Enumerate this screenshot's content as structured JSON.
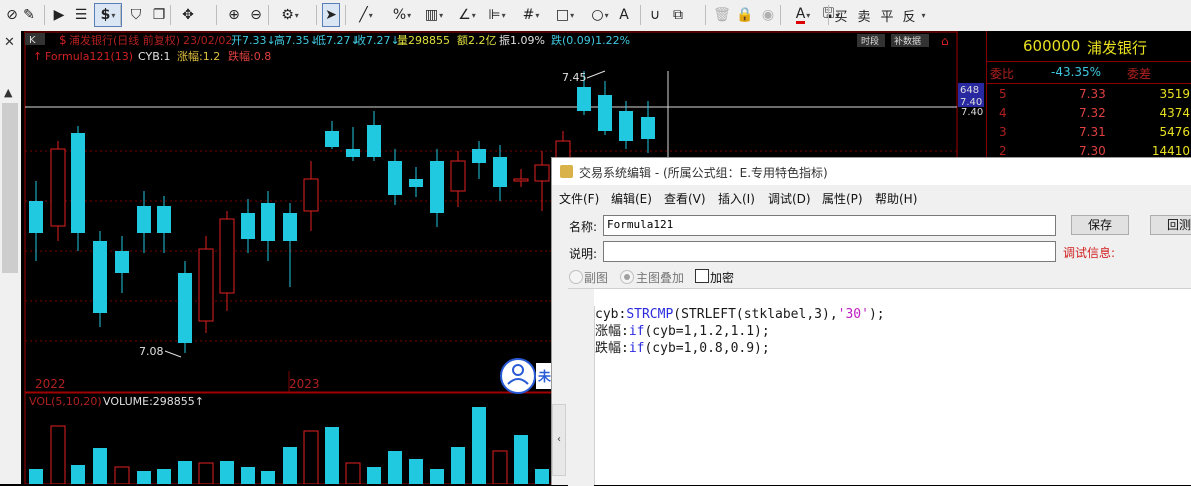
{
  "toolbar": {
    "items": [
      {
        "icon": "pointer-mode-icon",
        "glyph": "⊘"
      },
      {
        "icon": "edit-icon",
        "glyph": "✎"
      },
      {
        "icon": "play-icon",
        "glyph": "▶"
      },
      {
        "icon": "report-icon",
        "glyph": "☰"
      },
      {
        "icon": "dollar-icon",
        "glyph": "$"
      },
      {
        "icon": "filter-icon",
        "glyph": "⛉"
      },
      {
        "icon": "layers-icon",
        "glyph": "❐"
      },
      {
        "icon": "move-icon",
        "glyph": "✥"
      },
      {
        "icon": "zoom-in-icon",
        "glyph": "⊕"
      },
      {
        "icon": "zoom-out-icon",
        "glyph": "⊖"
      },
      {
        "icon": "settings-icon",
        "glyph": "⚙"
      },
      {
        "icon": "cursor-icon",
        "glyph": "➤"
      },
      {
        "icon": "line-tool-icon",
        "glyph": "╱"
      },
      {
        "icon": "percent-icon",
        "glyph": "%"
      },
      {
        "icon": "ruler-icon",
        "glyph": "▥"
      },
      {
        "icon": "angle-icon",
        "glyph": "∠"
      },
      {
        "icon": "align-icon",
        "glyph": "⊫"
      },
      {
        "icon": "grid-icon",
        "glyph": "#"
      },
      {
        "icon": "rectangle-icon",
        "glyph": "□"
      },
      {
        "icon": "circle-icon",
        "glyph": "○"
      },
      {
        "icon": "text-icon",
        "glyph": "A"
      },
      {
        "icon": "magnet-icon",
        "glyph": "∪"
      },
      {
        "icon": "copy-icon",
        "glyph": "⧉"
      },
      {
        "icon": "delete-icon",
        "glyph": "🗑"
      },
      {
        "icon": "lock-icon",
        "glyph": "🔒"
      },
      {
        "icon": "eye-icon",
        "glyph": "◉"
      },
      {
        "icon": "font-color-icon",
        "glyph": "A"
      },
      {
        "icon": "save-icon",
        "glyph": "🖫"
      }
    ],
    "trade_buttons": [
      "买",
      "卖",
      "平",
      "反"
    ]
  },
  "chart": {
    "period_tag": "K",
    "header_name": "浦发银行(日线 前复权)",
    "header_date": "23/02/02",
    "header_open": "开7.33↓",
    "header_high": "高7.35↓",
    "header_low": "低7.27↓",
    "header_close": "收7.27↓",
    "header_volume": "量298855",
    "header_amount": "额2.2亿",
    "header_amplitude": "振1.09%",
    "header_change": "跌(0.09)1.22%",
    "btn_time": "时段",
    "btn_fuquan": "补数据",
    "formula_name": "Formula121(13)",
    "formula_cyb": "CYB:1",
    "formula_zhangfu": "涨幅:1.2",
    "formula_diefu": "跌幅:0.8",
    "high_label": "7.45",
    "low_label": "7.08",
    "axis_label_1": "2022",
    "axis_label_2": "2023",
    "price_tag_1": "648",
    "price_tag_2": "7.40",
    "price_tag_3": "7.40",
    "volume_title": "VOL(5,10,20)",
    "volume_value": "VOLUME:298855↑",
    "float_icon_text": "未"
  },
  "chart_data": {
    "type": "candlestick",
    "low_label": 7.08,
    "high_label": 7.45,
    "volume_last": 298855
  },
  "quote_panel": {
    "code": "600000",
    "name": "浦发银行",
    "weibi_label": "委比",
    "weibi_value": "-43.35%",
    "weicha_label": "委差",
    "levels": [
      {
        "level": "5",
        "price": "7.33",
        "volume": "3519"
      },
      {
        "level": "4",
        "price": "7.32",
        "volume": "4374"
      },
      {
        "level": "3",
        "price": "7.31",
        "volume": "5476"
      },
      {
        "level": "2",
        "price": "7.30",
        "volume": "14410"
      }
    ]
  },
  "dialog": {
    "title": "交易系统编辑 - (所属公式组：E.专用特色指标)",
    "menu": [
      "文件(F)",
      "编辑(E)",
      "查看(V)",
      "插入(I)",
      "调试(D)",
      "属性(P)",
      "帮助(H)"
    ],
    "name_label": "名称:",
    "name_value": "Formula121",
    "desc_label": "说明:",
    "desc_value": "",
    "save_button": "保存",
    "return_button": "回测",
    "debug_info": "调试信息:",
    "radio_sub": "副图",
    "radio_main": "主图叠加",
    "check_encrypt": "加密",
    "code_line1_var": "cyb:",
    "code_line1_fn": "STRCMP",
    "code_line1_mid": "(STRLEFT(stklabel,3),",
    "code_line1_str": "'30'",
    "code_line1_end": ");",
    "code_line2_var": "涨幅:",
    "code_line2_kw": "if",
    "code_line2_rest": "(cyb=1,1.2,1.1);",
    "code_line3_var": "跌幅:",
    "code_line3_kw": "if",
    "code_line3_rest": "(cyb=1,0.8,0.9);"
  }
}
